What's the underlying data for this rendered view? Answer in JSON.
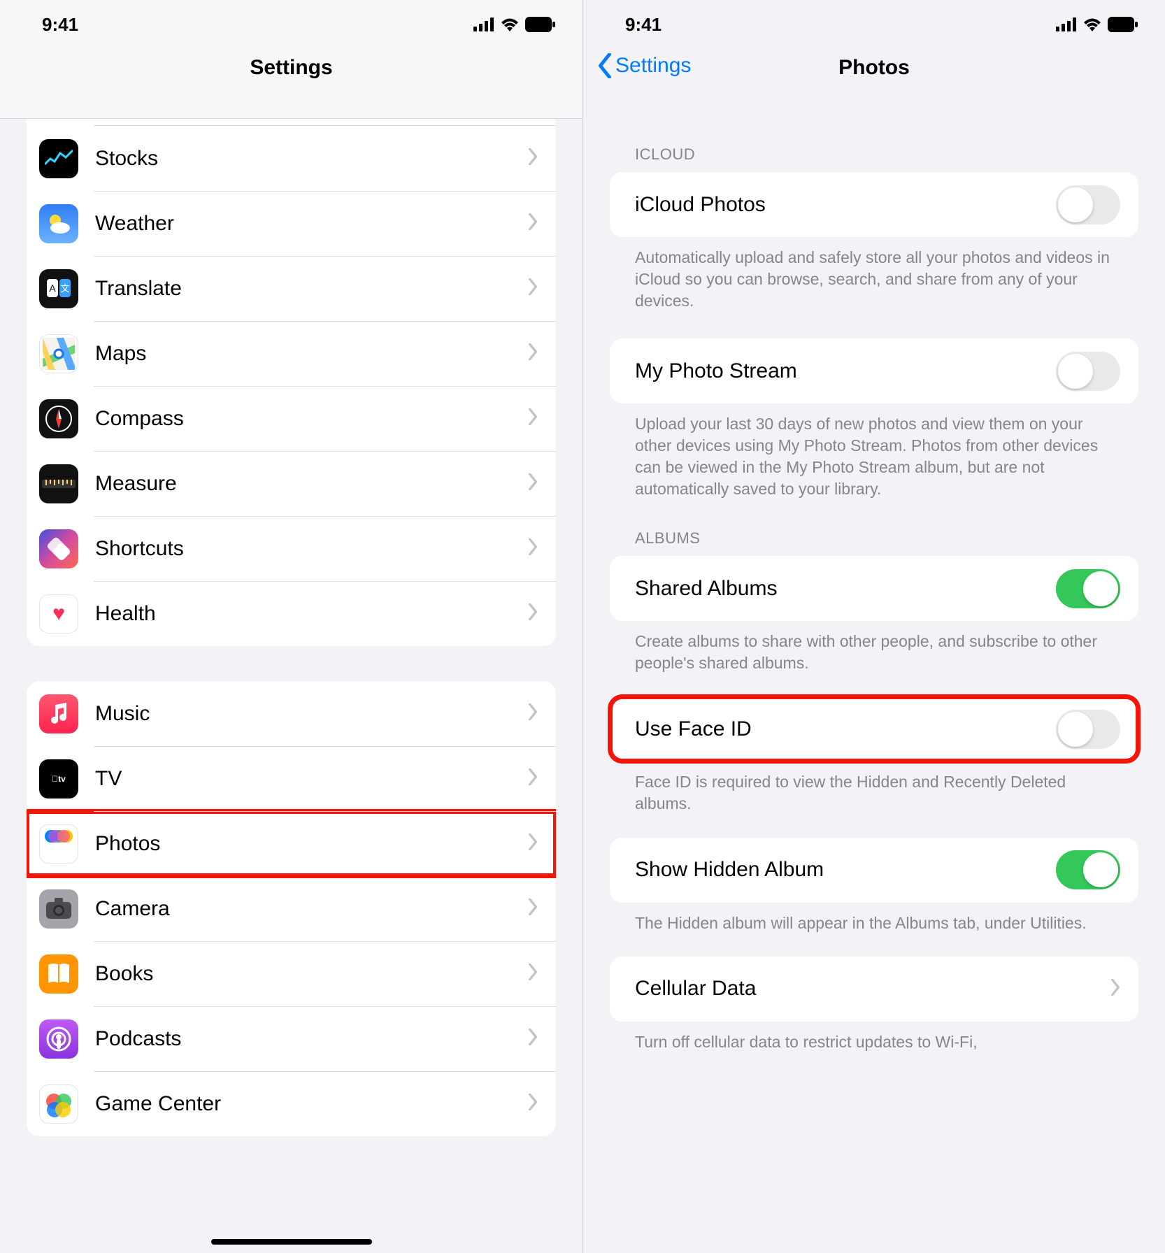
{
  "status": {
    "time": "9:41"
  },
  "left": {
    "title": "Settings",
    "group1": [
      {
        "label": "Stocks",
        "icon": "stocks"
      },
      {
        "label": "Weather",
        "icon": "weather"
      },
      {
        "label": "Translate",
        "icon": "translate"
      },
      {
        "label": "Maps",
        "icon": "maps"
      },
      {
        "label": "Compass",
        "icon": "compass"
      },
      {
        "label": "Measure",
        "icon": "measure"
      },
      {
        "label": "Shortcuts",
        "icon": "shortcuts"
      },
      {
        "label": "Health",
        "icon": "health"
      }
    ],
    "group2": [
      {
        "label": "Music",
        "icon": "music"
      },
      {
        "label": "TV",
        "icon": "tv"
      },
      {
        "label": "Photos",
        "icon": "photos",
        "highlight": true
      },
      {
        "label": "Camera",
        "icon": "camera"
      },
      {
        "label": "Books",
        "icon": "books"
      },
      {
        "label": "Podcasts",
        "icon": "podcasts"
      },
      {
        "label": "Game Center",
        "icon": "gamecenter"
      }
    ]
  },
  "right": {
    "back": "Settings",
    "title": "Photos",
    "sections": {
      "icloud": {
        "header": "ICLOUD",
        "icloud_photos": {
          "label": "iCloud Photos",
          "on": false
        },
        "icloud_desc": "Automatically upload and safely store all your photos and videos in iCloud so you can browse, search, and share from any of your devices.",
        "stream": {
          "label": "My Photo Stream",
          "on": false
        },
        "stream_desc": "Upload your last 30 days of new photos and view them on your other devices using My Photo Stream. Photos from other devices can be viewed in the My Photo Stream album, but are not automatically saved to your library."
      },
      "albums": {
        "header": "ALBUMS",
        "shared": {
          "label": "Shared Albums",
          "on": true
        },
        "shared_desc": "Create albums to share with other people, and subscribe to other people's shared albums.",
        "faceid": {
          "label": "Use Face ID",
          "on": false,
          "highlight": true
        },
        "faceid_desc": "Face ID is required to view the Hidden and Recently Deleted albums.",
        "hidden": {
          "label": "Show Hidden Album",
          "on": true
        },
        "hidden_desc": "The Hidden album will appear in the Albums tab, under Utilities.",
        "cellular": {
          "label": "Cellular Data"
        },
        "cellular_desc": "Turn off cellular data to restrict updates to Wi-Fi,"
      }
    }
  }
}
